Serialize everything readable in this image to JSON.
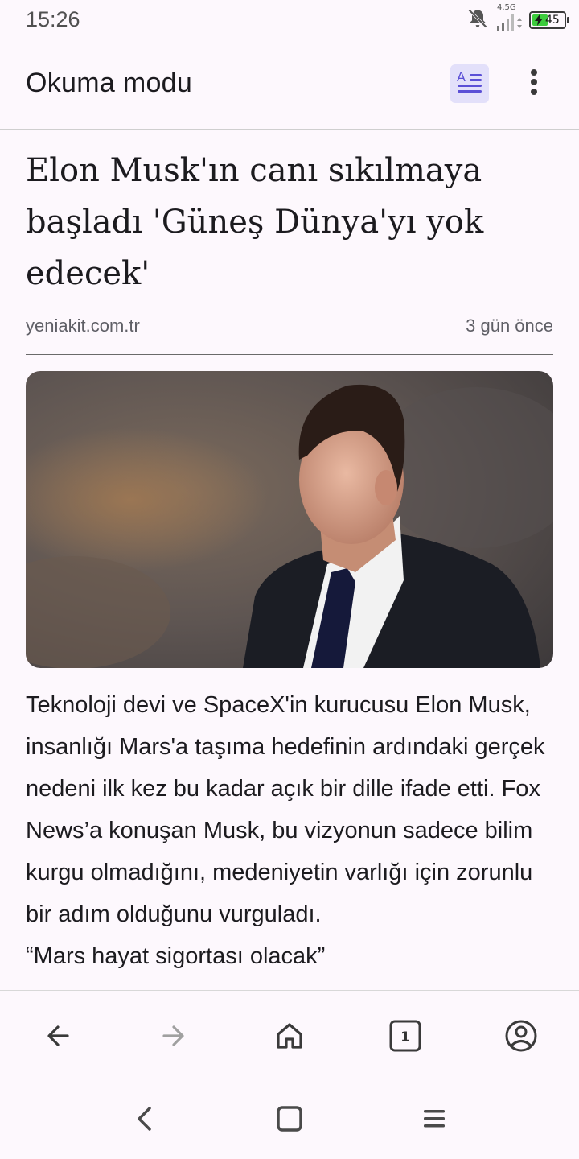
{
  "status_bar": {
    "time": "15:26",
    "network": "4.5G",
    "battery_level": "45",
    "battery_fraction": 0.45,
    "icons": [
      "bell-off-icon",
      "signal-icon",
      "battery-icon"
    ]
  },
  "app_bar": {
    "title": "Okuma modu",
    "reader_icon": "reader-mode-icon",
    "menu_icon": "more-vert-icon",
    "accent_color": "#5b4fd6"
  },
  "article": {
    "headline": "Elon Musk'ın canı sıkılmaya başladı 'Güneş Dünya'yı yok edecek'",
    "source": "yeniakit.com.tr",
    "time_ago": "3 gün önce",
    "image_icon": "article-photo",
    "paragraphs": [
      "Teknoloji devi ve SpaceX'in kurucusu Elon Musk, insanlığı Mars'a taşıma hedefinin ardındaki gerçek nedeni ilk kez bu kadar açık bir dille ifade etti. Fox News’a konuşan Musk, bu vizyonun sadece bilim kurgu olmadığını, medeniyetin varlığı için zorunlu bir adım olduğunu vurguladı.",
      "“Mars hayat sigortası olacak”"
    ]
  },
  "bottom_nav": {
    "items": [
      "back-icon",
      "forward-icon",
      "home-icon",
      "tabs-icon",
      "account-icon"
    ],
    "tab_count": "1"
  },
  "system_nav": {
    "items": [
      "system-back-icon",
      "system-home-icon",
      "system-recents-icon"
    ]
  }
}
